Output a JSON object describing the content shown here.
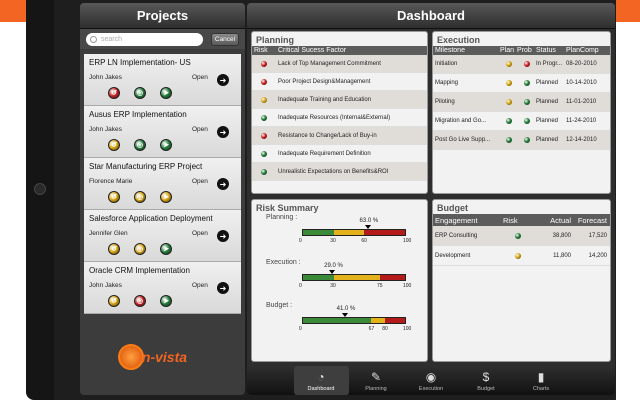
{
  "colors": {
    "accent": "#f26522",
    "red": "#c61a1a",
    "yellow": "#d4a20c",
    "green": "#1f7a35"
  },
  "header": {
    "projects_title": "Projects",
    "dashboard_title": "Dashboard"
  },
  "search": {
    "placeholder": "search",
    "cancel_label": "Cancel"
  },
  "projects": [
    {
      "name": "ERP LN Implementation- US",
      "manager": "John Jakes",
      "status": "Open",
      "dots": [
        "red",
        "green",
        "green"
      ]
    },
    {
      "name": "Ausus ERP Implementation",
      "manager": "John Jakes",
      "status": "Open",
      "dots": [
        "yellow",
        "green",
        "green"
      ]
    },
    {
      "name": "Star Manufacturing ERP Project",
      "manager": "Florence Marie",
      "status": "Open",
      "dots": [
        "yellow",
        "yellow",
        "yellow"
      ]
    },
    {
      "name": "Salesforce Application Deployment",
      "manager": "Jennifer Glen",
      "status": "Open",
      "dots": [
        "yellow",
        "yellow",
        "green"
      ]
    },
    {
      "name": "Oracle CRM Implementation",
      "manager": "John Jakes",
      "status": "Open",
      "dots": [
        "yellow",
        "red",
        "green"
      ]
    }
  ],
  "logo_text": "In-vista",
  "planning": {
    "title": "Planning",
    "col_risk": "Risk",
    "col_factor": "Critical Sucess Factor",
    "rows": [
      {
        "risk": "red",
        "factor": "Lack of Top Management Commitment"
      },
      {
        "risk": "red",
        "factor": "Poor Project Design&Management"
      },
      {
        "risk": "yellow",
        "factor": "Inadequate Training and Education"
      },
      {
        "risk": "green",
        "factor": "Inadequate Resources (Internal&External)"
      },
      {
        "risk": "red",
        "factor": "Resistance to Change/Lack of Buy-in"
      },
      {
        "risk": "green",
        "factor": "Inadequate Requirement Definition"
      },
      {
        "risk": "green",
        "factor": "Unrealistic Expectations on Benefits&ROI"
      }
    ]
  },
  "execution": {
    "title": "Execution",
    "col_milestone": "Milestone",
    "col_plan": "Plan",
    "col_prob": "Prob",
    "col_status": "Status",
    "col_plancomp": "PlanComp",
    "rows": [
      {
        "milestone": "Initiation",
        "plan": "yellow",
        "prob": "red",
        "status": "In Progr...",
        "date": "08-20-2010"
      },
      {
        "milestone": "Mapping",
        "plan": "yellow",
        "prob": "green",
        "status": "Planned",
        "date": "10-14-2010"
      },
      {
        "milestone": "Piloting",
        "plan": "yellow",
        "prob": "green",
        "status": "Planned",
        "date": "11-01-2010"
      },
      {
        "milestone": "Migration and Go...",
        "plan": "green",
        "prob": "green",
        "status": "Planned",
        "date": "11-24-2010"
      },
      {
        "milestone": "Post Go Live Supp...",
        "plan": "green",
        "prob": "green",
        "status": "Planned",
        "date": "12-14-2010"
      }
    ]
  },
  "risk_summary": {
    "title": "Risk Summary",
    "gauges": [
      {
        "label": "Planning :",
        "value": 63.0,
        "value_text": "63.0 %",
        "segments": [
          30,
          60,
          100
        ],
        "ticks": [
          "0",
          "30",
          "60",
          "100"
        ]
      },
      {
        "label": "Execution :",
        "value": 29.0,
        "value_text": "29.0 %",
        "segments": [
          30,
          75,
          100
        ],
        "ticks": [
          "0",
          "30",
          "75",
          "100"
        ]
      },
      {
        "label": "Budget :",
        "value": 41.0,
        "value_text": "41.0 %",
        "segments": [
          67,
          80,
          100
        ],
        "ticks": [
          "0",
          "67",
          "80",
          "100"
        ]
      }
    ]
  },
  "budget": {
    "title": "Budget",
    "col_engagement": "Engagement",
    "col_risk": "Risk",
    "col_actual": "Actual",
    "col_forecast": "Forecast",
    "rows": [
      {
        "engagement": "ERP Consulting",
        "risk": "green",
        "actual": "38,800",
        "forecast": "17,520"
      },
      {
        "engagement": "Development",
        "risk": "yellow",
        "actual": "11,800",
        "forecast": "14,200"
      }
    ]
  },
  "tabs": [
    {
      "label": "Dashboard",
      "icon": "dashboard-icon",
      "selected": true
    },
    {
      "label": "Planning",
      "icon": "planning-icon",
      "selected": false
    },
    {
      "label": "Execution",
      "icon": "execution-icon",
      "selected": false
    },
    {
      "label": "Budget",
      "icon": "dollar-icon",
      "selected": false
    },
    {
      "label": "Charts",
      "icon": "bar-chart-icon",
      "selected": false
    }
  ]
}
